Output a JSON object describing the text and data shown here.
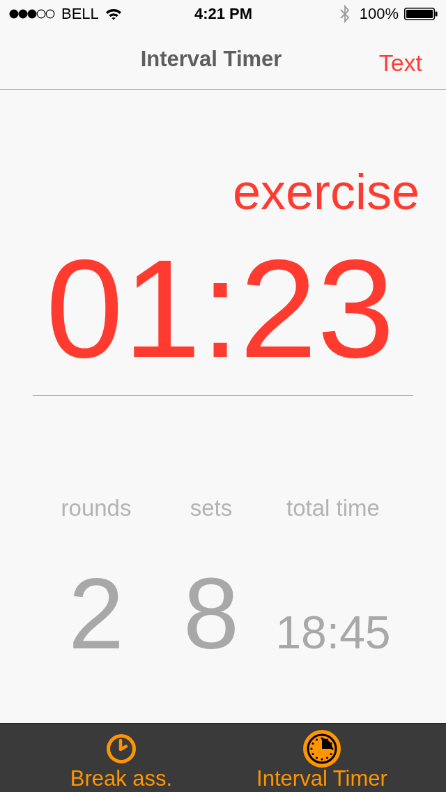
{
  "status_bar": {
    "carrier": "BELL",
    "time": "4:21 PM",
    "battery": "100%"
  },
  "nav_bar": {
    "title": "Interval Timer",
    "right_button": "Text"
  },
  "timer": {
    "phase": "exercise",
    "time": "01:23"
  },
  "stats": [
    {
      "label": "rounds",
      "value": "2",
      "kind": "count"
    },
    {
      "label": "sets",
      "value": "8",
      "kind": "count"
    },
    {
      "label": "total time",
      "value": "18:45",
      "kind": "time"
    }
  ],
  "tab_bar": {
    "tabs": [
      {
        "label": "Break ass.",
        "kind": "clock",
        "selected": false
      },
      {
        "label": "Interval Timer",
        "kind": "timer",
        "selected": true
      }
    ]
  }
}
